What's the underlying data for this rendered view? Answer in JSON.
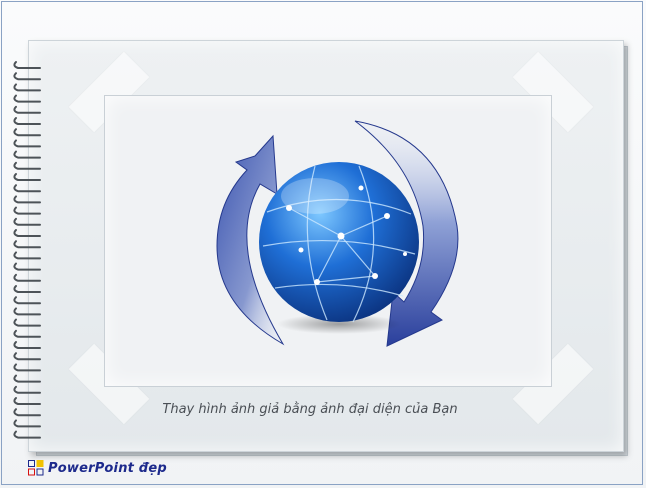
{
  "caption": "Thay hình ảnh giả bằng ảnh đại diện của Bạn",
  "brand": {
    "text": "PowerPoint đẹp",
    "colors": {
      "primary": "#1d2a8c",
      "accent": "#d60f0f",
      "secondary": "#f2c200"
    }
  },
  "illustration": {
    "icon": "globe-sync-icon"
  }
}
